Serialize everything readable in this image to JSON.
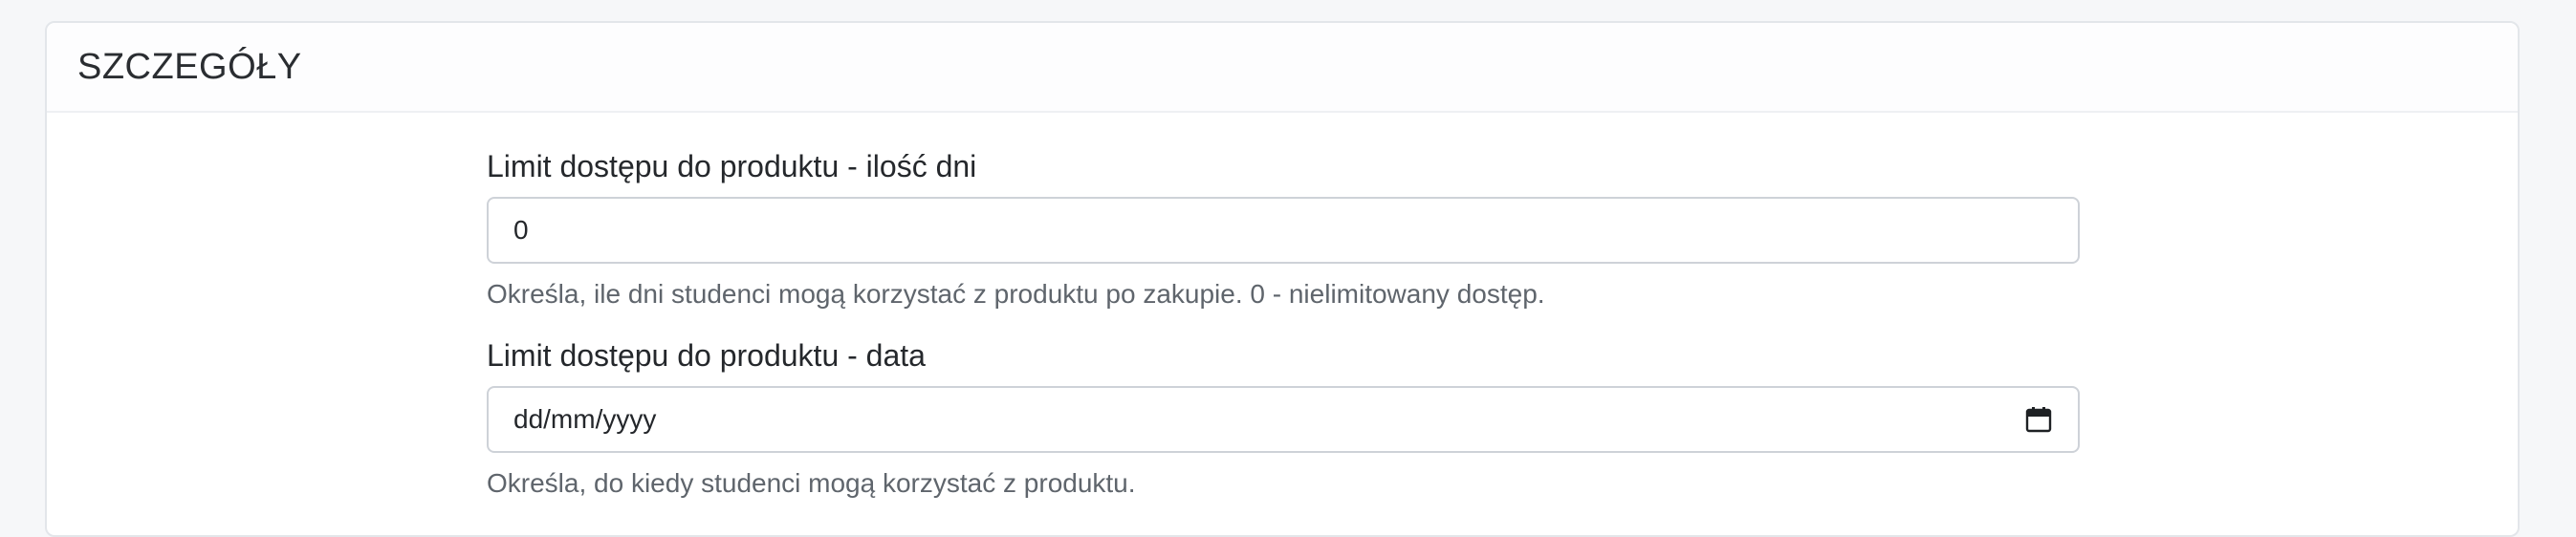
{
  "panel": {
    "title": "SZCZEGÓŁY"
  },
  "fields": [
    {
      "label": "Limit dostępu do produktu - ilość dni",
      "value": "0",
      "help": "Określa, ile dni studenci mogą korzystać z produktu po zakupie. 0 - nielimitowany dostęp."
    },
    {
      "label": "Limit dostępu do produktu - data",
      "placeholder": "dd/mm/yyyy",
      "icon": "calendar-icon",
      "help": "Określa, do kiedy studenci mogą korzystać z produktu."
    }
  ]
}
